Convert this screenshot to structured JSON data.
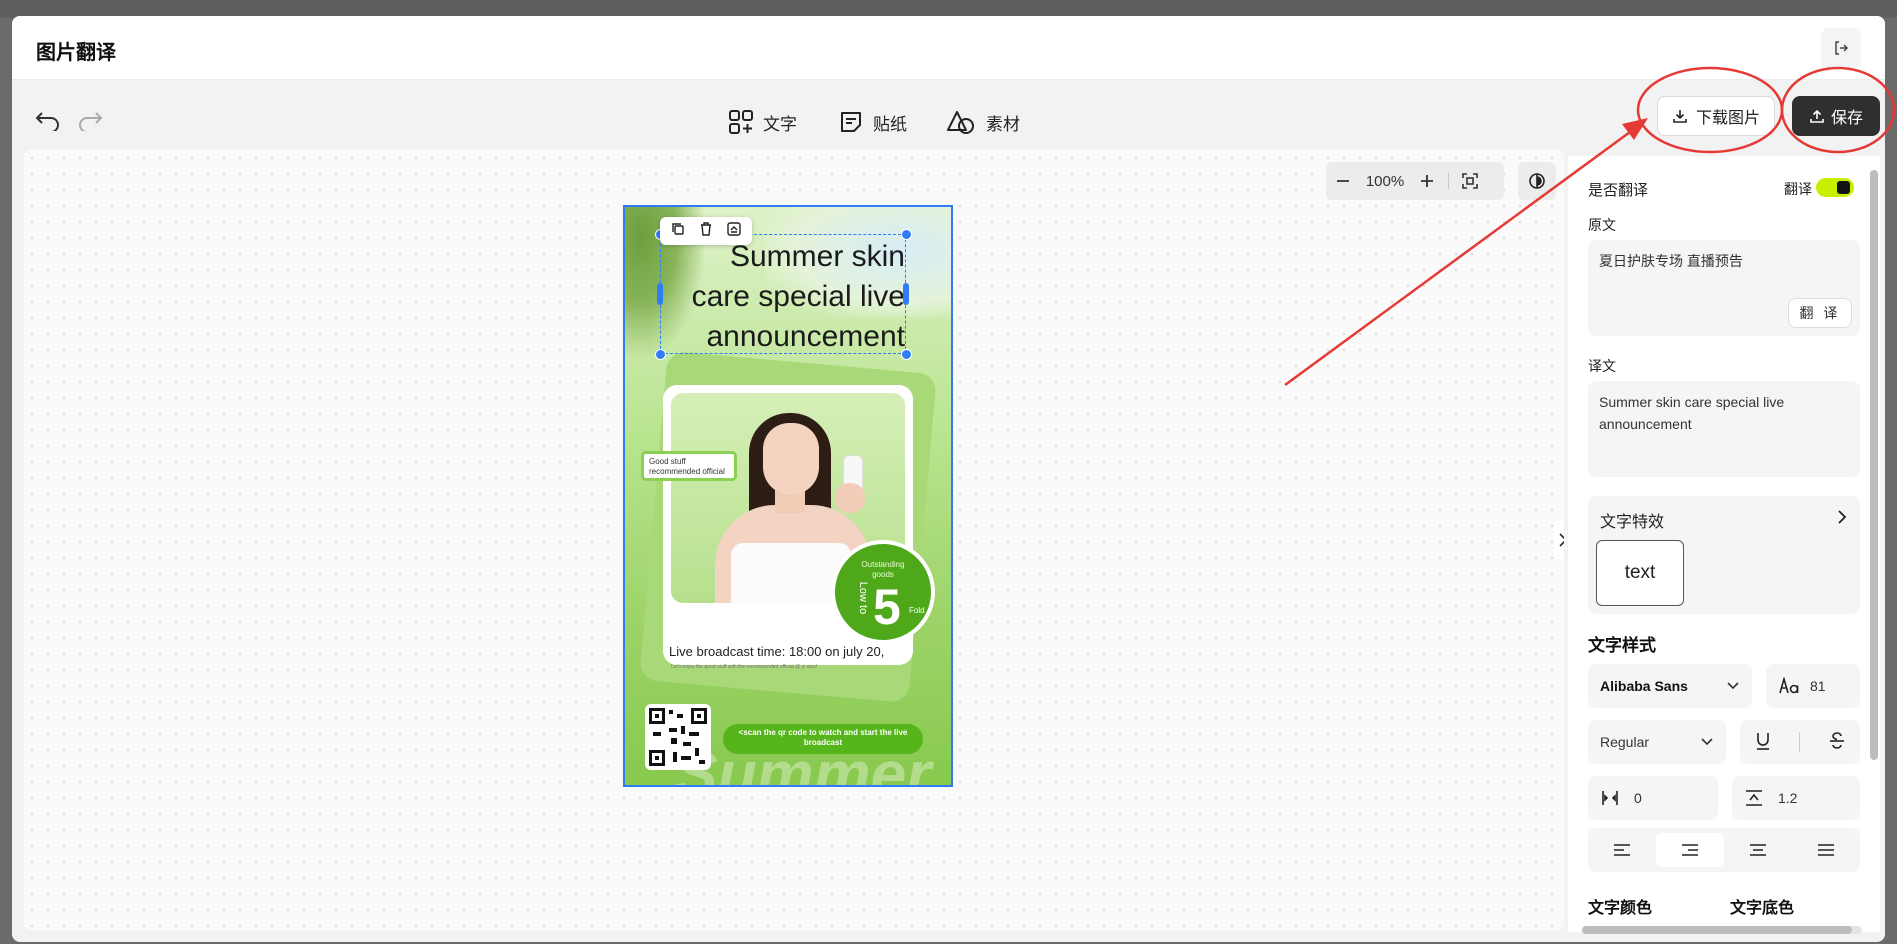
{
  "window": {
    "title": "图片翻译"
  },
  "toolbar": {
    "tools": [
      {
        "label": "文字",
        "icon": "add-text-grid-icon"
      },
      {
        "label": "贴纸",
        "icon": "sticker-icon"
      },
      {
        "label": "素材",
        "icon": "shapes-icon"
      }
    ],
    "download_label": "下载图片",
    "save_label": "保存"
  },
  "zoom": {
    "value": "100%"
  },
  "poster": {
    "title": "Summer skin care special live announcement",
    "title_lines": [
      "Summer skin",
      "care special live",
      "announcement"
    ],
    "badge_lines": [
      "Good stuff",
      "recommended official"
    ],
    "circle_top": [
      "Outstanding",
      "goods"
    ],
    "circle_low": "Low to",
    "circle_number": "5",
    "circle_fold": "Fold",
    "live_time": "Live broadcast time: 18:00 on july 20,",
    "live_sub": "Let's enjoy the good stuff with the recommended official @ yi xiao!",
    "scan_text": "<scan the qr code to watch and start the live broadcast",
    "watermark": "Summer"
  },
  "panel": {
    "translate_toggle_label": "是否翻译",
    "translate_switch_label": "翻译",
    "translate_enabled": true,
    "original_label": "原文",
    "original_text": "夏日护肤专场 直播预告",
    "translate_button": "翻 译",
    "translated_label": "译文",
    "translated_text": "Summer skin care special live announcement",
    "effects_label": "文字特效",
    "effect_sample": "text",
    "text_style_label": "文字样式",
    "font_family": "Alibaba Sans",
    "font_size": "81",
    "font_weight": "Regular",
    "letter_spacing": "0",
    "line_height": "1.2",
    "text_color_label": "文字颜色",
    "bg_color_label": "文字底色",
    "alignment_selected": "right"
  },
  "colors": {
    "accent": "#2f7cf6",
    "toggle": "#c7f000",
    "save_bg": "#2f2f2f",
    "annotation": "#e53935"
  }
}
